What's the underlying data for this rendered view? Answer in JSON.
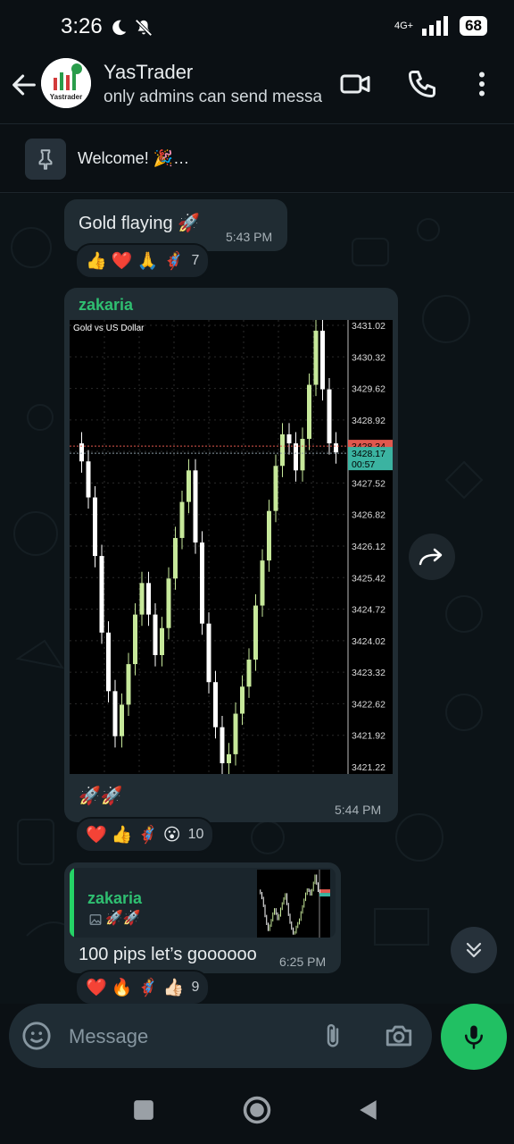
{
  "status_bar": {
    "time": "3:26",
    "network": "4G+",
    "battery": "68"
  },
  "header": {
    "chat_name": "YasTrader",
    "subtitle": "only admins can send messages",
    "avatar_text": "Yastrader"
  },
  "pinned": {
    "text": "Welcome! 🎉…"
  },
  "messages": [
    {
      "text": "Gold flaying 🚀",
      "time": "5:43 PM",
      "reactions": "👍 ❤️ 🙏 🦸‍♀️",
      "reaction_count": "7"
    },
    {
      "sender": "zakaria",
      "chart_title": "Gold vs US Dollar",
      "caption": "🚀🚀",
      "time": "5:44 PM",
      "reactions": "❤️ 👍 🦸‍♀️ 😮",
      "reaction_count": "10"
    },
    {
      "quote_sender": "zakaria",
      "quote_caption": "🚀🚀",
      "text": "100 pips let’s goooooo",
      "time": "6:25 PM",
      "reactions": "❤️ 🔥 🦸‍♀️ 👍🏻",
      "reaction_count": "9"
    }
  ],
  "chart_data": {
    "type": "candlestick",
    "title": "Gold vs US Dollar",
    "ylim": [
      3421.22,
      3431.02
    ],
    "y_ticks": [
      "3431.02",
      "3430.32",
      "3429.62",
      "3428.92",
      "3428.34",
      "3427.52",
      "3426.82",
      "3426.12",
      "3425.42",
      "3424.72",
      "3424.02",
      "3423.32",
      "3422.62",
      "3421.92",
      "3421.22"
    ],
    "bid_line": 3428.34,
    "ask_label": "3428.17",
    "countdown": "00:57",
    "colors": {
      "bull": "#c6e89a",
      "bear": "#ffffff",
      "bid": "#e0584e",
      "ask": "#3bb3a1"
    }
  },
  "composer": {
    "placeholder": "Message"
  },
  "colors": {
    "accent": "#25d366",
    "bubble": "#202c33",
    "background": "#0b1014"
  }
}
